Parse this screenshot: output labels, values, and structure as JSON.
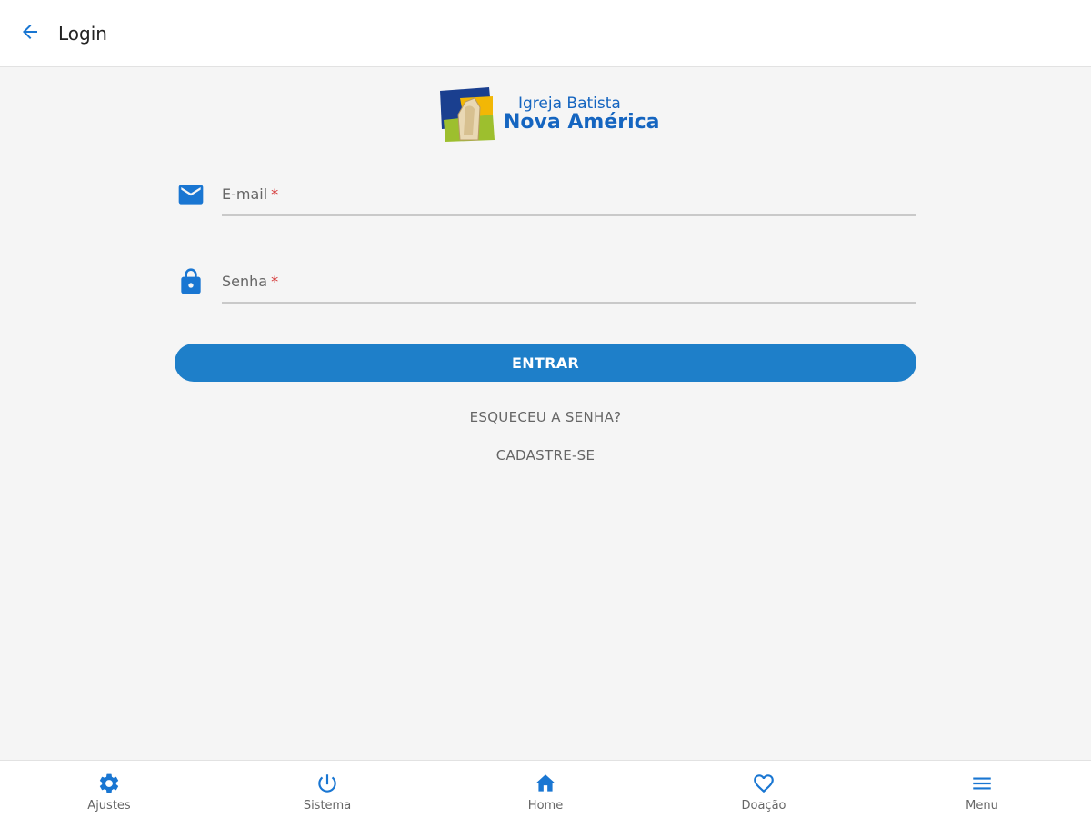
{
  "appbar": {
    "title": "Login",
    "back_icon": "arrow-back-icon"
  },
  "logo": {
    "line1": "Igreja Batista",
    "line2": "Nova América"
  },
  "form": {
    "email": {
      "label": "E-mail",
      "required_mark": "*",
      "value": "",
      "icon": "mail-icon"
    },
    "password": {
      "label": "Senha",
      "required_mark": "*",
      "value": "",
      "icon": "lock-icon"
    },
    "submit_label": "ENTRAR",
    "forgot_label": "ESQUECEU A SENHA?",
    "register_label": "CADASTRE-SE"
  },
  "bottom_nav": [
    {
      "label": "Ajustes",
      "icon": "gear-icon"
    },
    {
      "label": "Sistema",
      "icon": "power-icon"
    },
    {
      "label": "Home",
      "icon": "home-icon"
    },
    {
      "label": "Doação",
      "icon": "heart-icon"
    },
    {
      "label": "Menu",
      "icon": "hamburger-menu-icon"
    }
  ],
  "colors": {
    "primary": "#1e7fc9",
    "icon_blue": "#1976d2",
    "background": "#f5f5f5",
    "required": "#d32f2f"
  }
}
